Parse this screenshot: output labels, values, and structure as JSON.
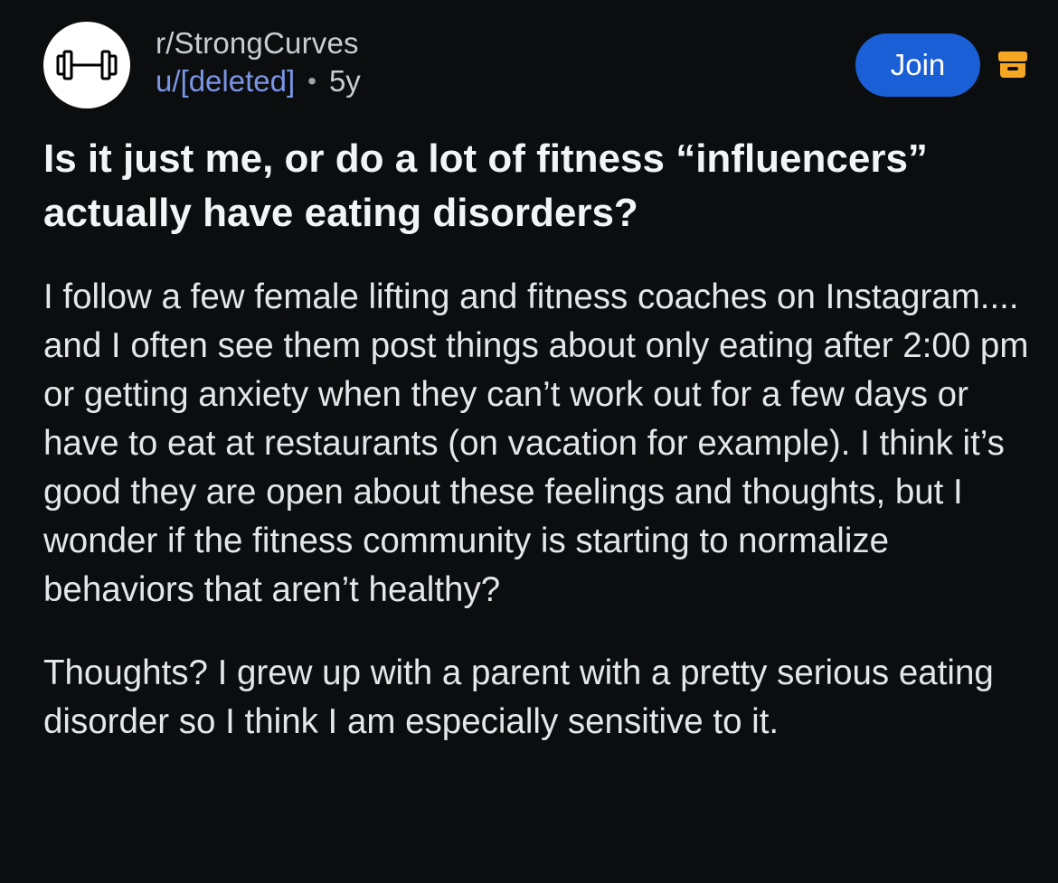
{
  "header": {
    "subreddit": "r/StrongCurves",
    "author": "u/[deleted]",
    "separator": "•",
    "age": "5y",
    "join_label": "Join",
    "avatar_icon": "barbell-icon",
    "archive_icon": "archive-icon"
  },
  "post": {
    "title": "Is it just me, or do a lot of fitness “influencers” actually have eating disorders?",
    "paragraphs": [
      "I follow a few female lifting and fitness coaches on Instagram.... and I often see them post things about only eating after 2:00 pm or getting anxiety when they can’t work out for a few days or have to eat at restaurants (on vacation for example). I think it’s good they are open about these feelings and thoughts, but I wonder if the fitness community is starting to normalize behaviors that aren’t healthy?",
      "Thoughts? I grew up with a parent with a pretty serious eating disorder so I think I am especially sensitive to it."
    ]
  },
  "colors": {
    "background": "#0b0d0f",
    "join_button": "#1a5fd6",
    "author_link": "#7b95e5",
    "archive_icon": "#f5a623"
  }
}
